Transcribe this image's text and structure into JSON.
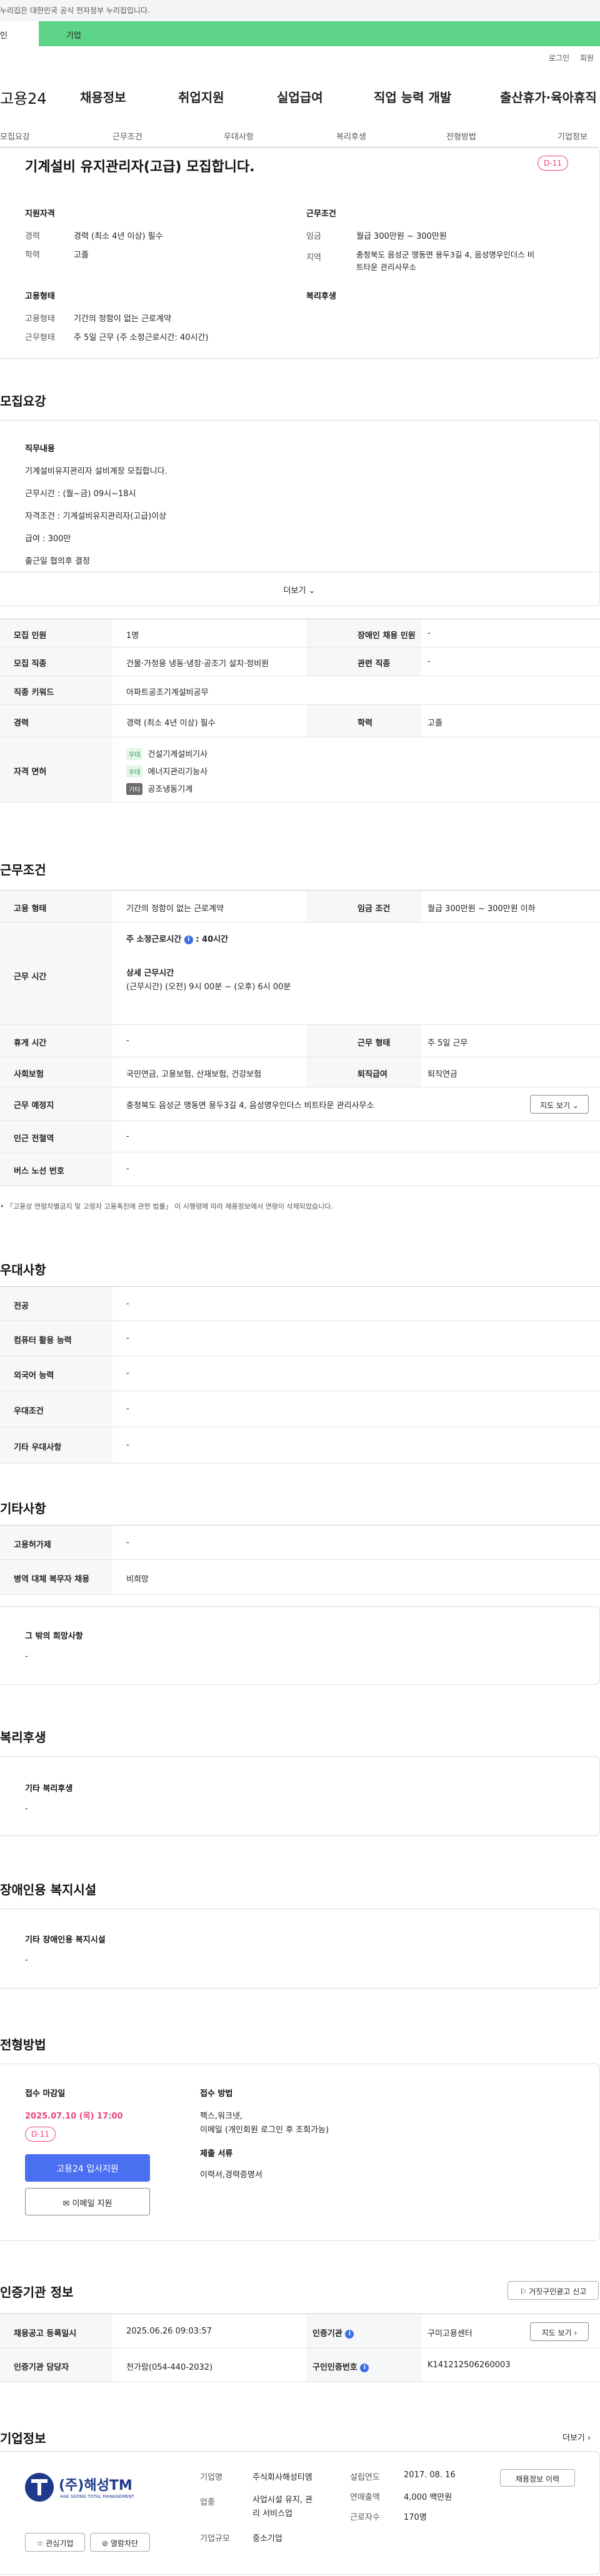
{
  "gov_banner": "누리집은 대한민국 공식 전자정부 누리집입니다.",
  "top_tabs": {
    "individual": "인",
    "business": "기업"
  },
  "util": {
    "login": "로그인",
    "join": "회원"
  },
  "gnb": {
    "logo": "고용24",
    "items": [
      "채용정보",
      "취업지원",
      "실업급여",
      "직업 능력 개발",
      "출산휴가·육아휴직"
    ]
  },
  "subnav": [
    "모집요강",
    "근무조건",
    "우대사항",
    "복리후생",
    "전형방법",
    "기업정보"
  ],
  "summary": {
    "title": "기계설비 유지관리자(고급) 모집합니다.",
    "dday": "D-11",
    "qual_heading": "지원자격",
    "qual": [
      {
        "label": "경력",
        "value": "경력 (최소 4년 이상) 필수"
      },
      {
        "label": "학력",
        "value": "고졸"
      }
    ],
    "cond_heading": "근무조건",
    "cond": [
      {
        "label": "임금",
        "value": "월급 300만원 ~ 300만원"
      },
      {
        "label": "지역",
        "value": "충청북도 음성군 맹동면 용두3길 4, 음성명우인더스 비",
        "value2": "트타운 관리사무소"
      }
    ],
    "emp_heading": "고용형태",
    "emp": [
      {
        "label": "고용형태",
        "value": "기간의 정함이 없는 근로계약"
      },
      {
        "label": "근무형태",
        "value": "주 5일 근무 (주 소정근로시간: 40시간)"
      }
    ],
    "welfare_heading": "복리후생"
  },
  "recruit": {
    "heading": "모집요강",
    "job_heading": "직무내용",
    "lines": [
      "기계설비유지관리자 설비계장 모집합니다.",
      "근무시간 : (월~금) 09시~18시",
      "자격조건 : 기계설비유지관리자(고급)이상",
      "급여 : 300만",
      "출근일 협의후 결정"
    ],
    "more": "더보기",
    "table": {
      "r1": {
        "l1": "모집 인원",
        "v1": "1명",
        "l2": "장애인 채용 인원",
        "v2": "-"
      },
      "r2": {
        "l1": "모집 직종",
        "v1": "건물·가정용 냉동·냉장·공조기 설치·정비원",
        "l2": "관련 직종",
        "v2": "-"
      },
      "r3": {
        "l1": "직종 키워드",
        "v1": "아파트공조기계설비공무"
      },
      "r4": {
        "l1": "경력",
        "v1": "경력 (최소 4년 이상) 필수",
        "l2": "학력",
        "v2": "고졸"
      },
      "r5": {
        "l1": "자격 면허",
        "licenses": [
          {
            "tag": "우대",
            "name": "건설기계설비기사"
          },
          {
            "tag": "우대",
            "name": "에너지관리기능사"
          },
          {
            "tag": "기타",
            "name": "공조냉동기계"
          }
        ]
      }
    }
  },
  "work": {
    "heading": "근무조건",
    "r1": {
      "l1": "고용 형태",
      "v1": "기간의 정함이 없는 근로계약",
      "l2": "임금 조건",
      "v2": "월급 300만원 ~ 300만원 이하"
    },
    "r2": {
      "l1": "근무 시간",
      "weekly": "주 소정근로시간",
      "weekly_icon": "i",
      "weekly_val": ": 40시간",
      "detail_title": "상세 근무시간",
      "detail": "(근무시간) (오전) 9시 00분 ~ (오후) 6시 00분"
    },
    "r3": {
      "l1": "휴게 시간",
      "v1": "-",
      "l2": "근무 형태",
      "v2": "주 5일 근무"
    },
    "r4": {
      "l1": "사회보험",
      "v1": "국민연금, 고용보험, 산재보험, 건강보험",
      "l2": "퇴직급여",
      "v2": "퇴직연금"
    },
    "r5": {
      "l1": "근무 예정지",
      "v1": "충청북도 음성군 맹동면 용두3길 4, 음성명우인더스 비트타운 관리사무소",
      "btn": "지도 보기"
    },
    "r6": {
      "l1": "인근 전철역",
      "v1": "-"
    },
    "r7": {
      "l1": "버스 노선 번호",
      "v1": "-"
    },
    "note": "「고용상 연령차별금지 및 고령자 고용촉진에 관한 법률」 이 시행령에 따라 채용정보에서 연령이 삭제되었습니다."
  },
  "pref": {
    "heading": "우대사항",
    "rows": [
      {
        "label": "전공",
        "value": "-"
      },
      {
        "label": "컴퓨터 활용 능력",
        "value": "-"
      },
      {
        "label": "외국어 능력",
        "value": "-"
      },
      {
        "label": "우대조건",
        "value": "-"
      },
      {
        "label": "기타 우대사항",
        "value": "-"
      }
    ]
  },
  "etc": {
    "heading": "기타사항",
    "rows": [
      {
        "label": "고용허가제",
        "value": "-"
      },
      {
        "label": "병역 대체 복무자 채용",
        "value": "비희망"
      }
    ],
    "box_title": "그 밖의 희망사항",
    "box_value": "-"
  },
  "welfare": {
    "heading": "복리후생",
    "box_title": "기타 복리후생",
    "box_value": "-"
  },
  "disabled": {
    "heading": "장애인용 복지시설",
    "box_title": "기타 장애인용 복지시설",
    "box_value": "-"
  },
  "process": {
    "heading": "전형방법",
    "deadline_label": "접수 마감일",
    "deadline": "2025.07.10 (목) 17:00",
    "dday": "D-11",
    "apply_btn": "고용24 입사지원",
    "email_btn": "이메일 지원",
    "method_label": "접수 방법",
    "methods": [
      "팩스,워크넷,",
      "이메일 (개인회원 로그인 후 조회가능)"
    ],
    "docs_label": "제출 서류",
    "docs": "이력서,경력증명서"
  },
  "agency": {
    "heading": "인증기관 정보",
    "report_btn": "거짓구인광고 신고",
    "r1": {
      "l1": "채용공고 등록일시",
      "v1": "2025.06.26 09:03:57",
      "l2": "인증기관",
      "v2": "구미고용센터",
      "btn": "지도 보기"
    },
    "r2": {
      "l1": "인증기관 담당자",
      "v1": "천가람(054-440-2032)",
      "l2": "구인인증번호",
      "v2": "K141212506260003"
    }
  },
  "company": {
    "heading": "기업정보",
    "more": "더보기",
    "logo_text": "(주)해성TM",
    "logo_sub": "HAE SEONG TOTAL MANAGEMENT",
    "fav_btn": "관심기업",
    "block_btn": "열람차단",
    "info_btn": "채용정보 이력",
    "fields": [
      {
        "label": "기업명",
        "value": "주식회사해성티엠"
      },
      {
        "label": "업종",
        "value": "사업시설 유지, 관",
        "value2": "리 서비스업"
      },
      {
        "label": "기업규모",
        "value": "중소기업"
      }
    ],
    "fields2": [
      {
        "label": "설립연도",
        "value": "2017. 08. 16"
      },
      {
        "label": "연매출액",
        "value": "4,000 백만원"
      },
      {
        "label": "근로자수",
        "value": "170명"
      }
    ]
  },
  "colors": {
    "accent_green": "#5ed488",
    "dday_pink": "#e8457a",
    "primary_blue": "#4a6ff0",
    "th_bg": "#f6f7f9"
  }
}
